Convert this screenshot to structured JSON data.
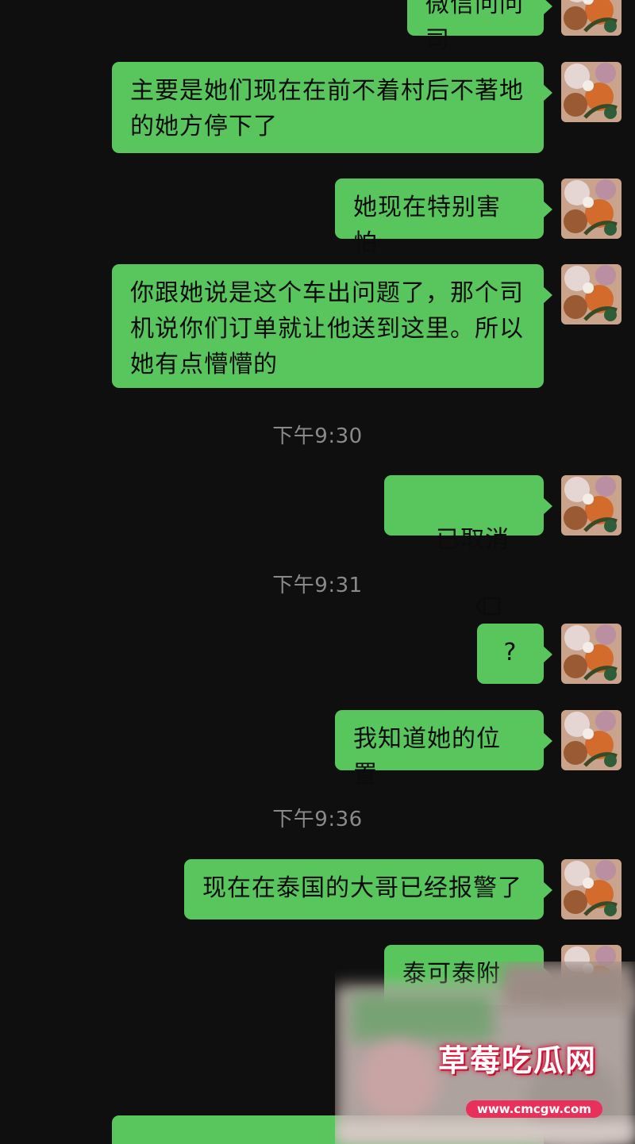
{
  "chat": {
    "messages": [
      {
        "text": "微信问问司"
      },
      {
        "text": "主要是她们现在在前不着村后不著地\n的她方停下了"
      },
      {
        "text": "她现在特别害怕"
      },
      {
        "text": "你跟她说是这个车出问题了，那个司\n机说你们订单就让他送到这里。所以\n她有点懵懵的"
      },
      {
        "text": "已取消"
      },
      {
        "text": "?"
      },
      {
        "text": "我知道她的位置"
      },
      {
        "text": "现在在泰国的大哥已经报警了"
      },
      {
        "text": "泰可泰附"
      },
      {
        "text": ""
      }
    ],
    "timestamps": [
      "下午9:30",
      "下午9:31",
      "下午9:36"
    ]
  },
  "colors": {
    "background": "#0f0f0f",
    "bubble_green": "#58c65c",
    "bubble_text": "#0c0c0c",
    "timestamp": "#8a8a8a"
  },
  "icons": {
    "call": "voice-call-icon",
    "avatar": "floral-avatar"
  },
  "watermark": {
    "title": "草莓吃瓜网",
    "url": "www.cmcgw.com"
  }
}
